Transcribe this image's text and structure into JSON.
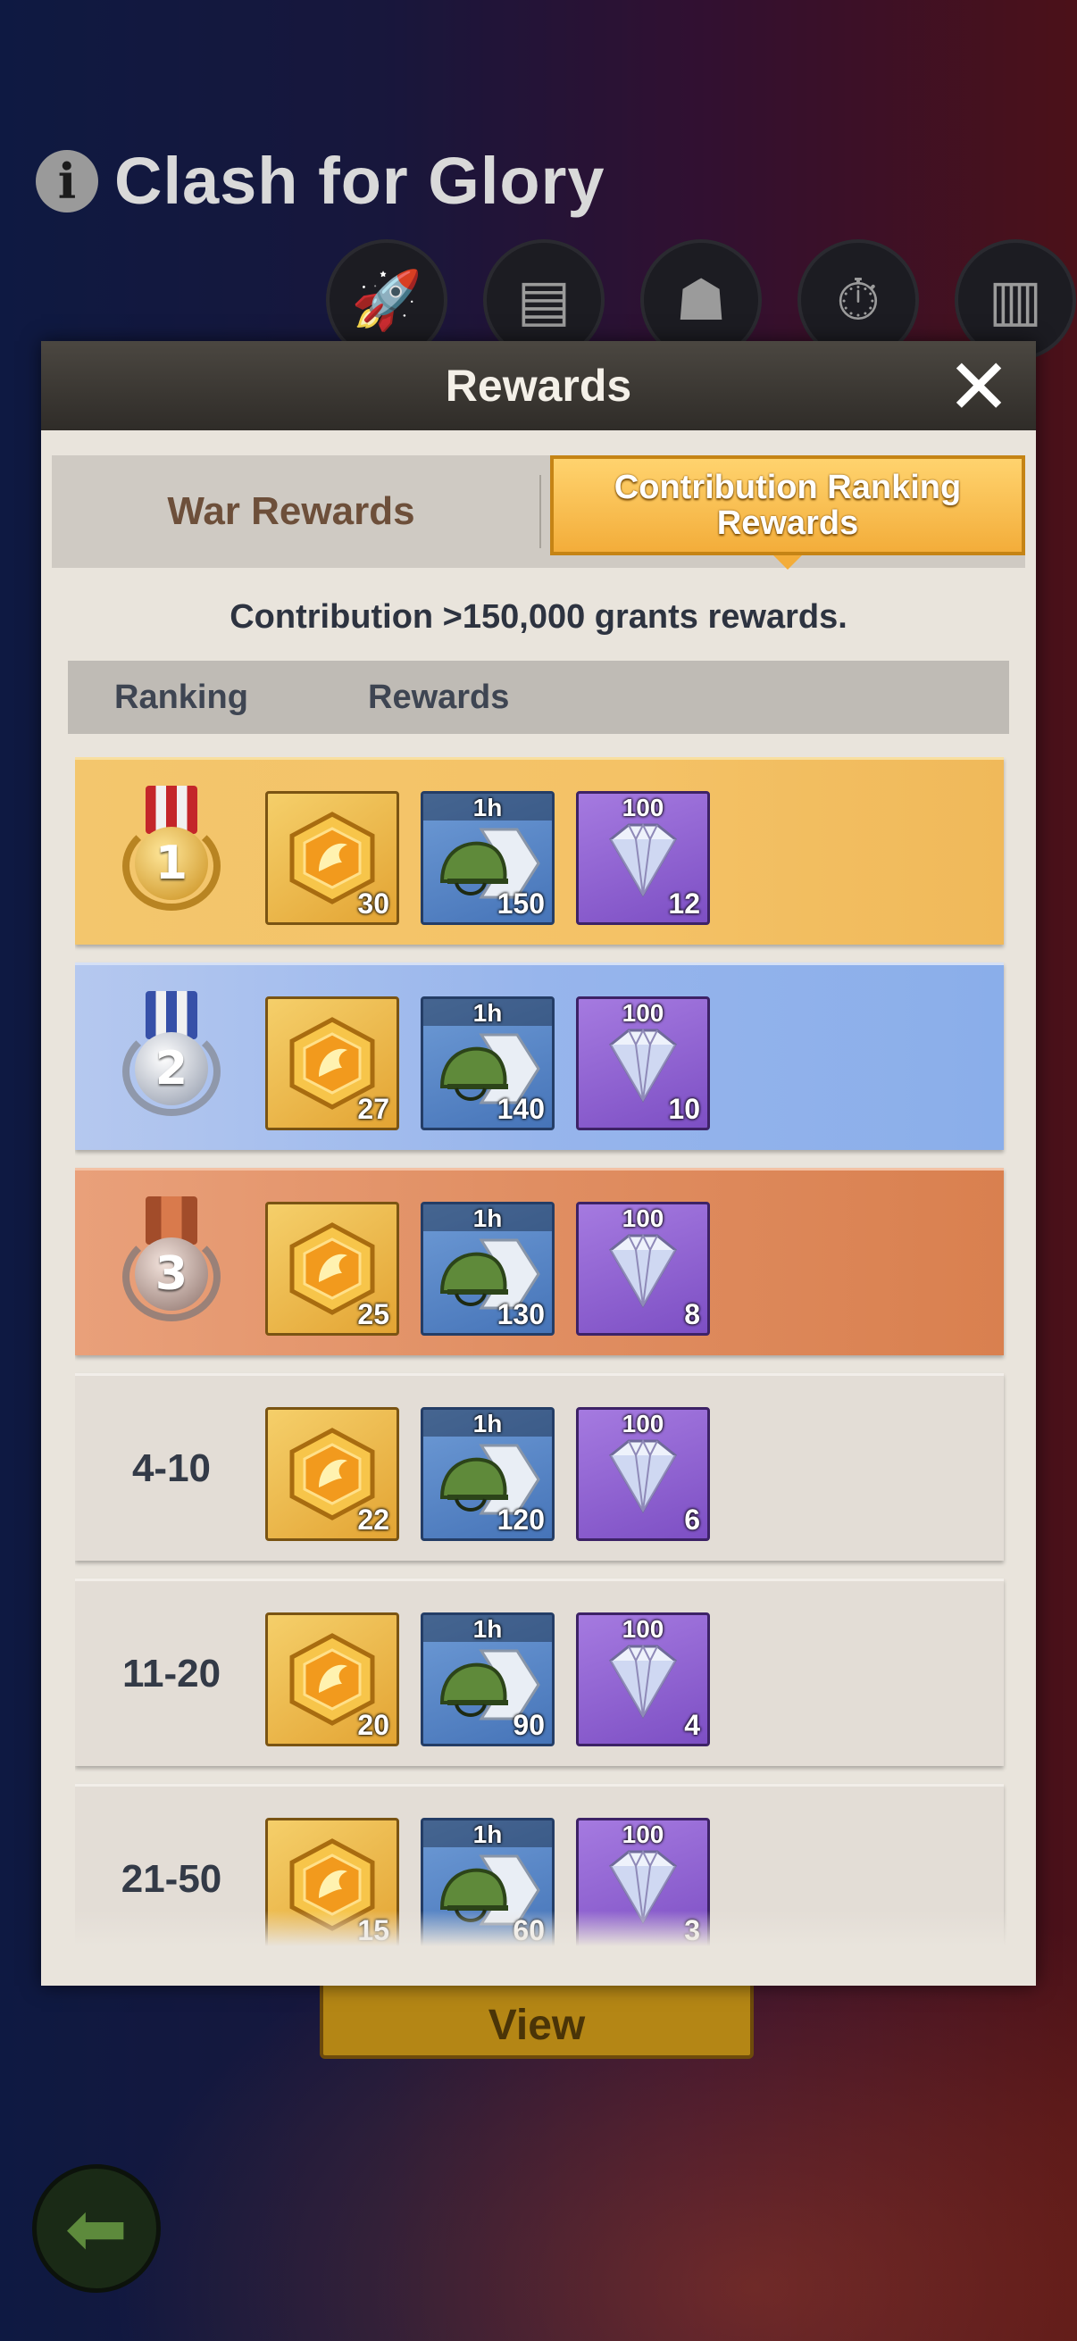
{
  "game": {
    "title": "Clash for Glory"
  },
  "feature_icons": [
    {
      "icon": "missile-icon"
    },
    {
      "icon": "document-icon"
    },
    {
      "icon": "soldier-gift-icon"
    },
    {
      "icon": "stopwatch-icon"
    },
    {
      "icon": "podium-icon"
    }
  ],
  "modal": {
    "title": "Rewards",
    "close_label": "✕",
    "tabs": {
      "war": "War Rewards",
      "contribution": "Contribution Ranking Rewards",
      "active": "contribution"
    },
    "threshold_text": "Contribution >150,000 grants rewards.",
    "columns": {
      "ranking": "Ranking",
      "rewards": "Rewards"
    },
    "item_labels": {
      "speedup_duration": "1h",
      "gem_amount": "100"
    },
    "rows": [
      {
        "rank": "1",
        "style": "gold",
        "medal": true,
        "medal_qty": "30",
        "speedup_qty": "150",
        "gem_qty": "12"
      },
      {
        "rank": "2",
        "style": "blue",
        "medal": true,
        "medal_qty": "27",
        "speedup_qty": "140",
        "gem_qty": "10"
      },
      {
        "rank": "3",
        "style": "bronze",
        "medal": true,
        "medal_qty": "25",
        "speedup_qty": "130",
        "gem_qty": "8"
      },
      {
        "rank": "4-10",
        "style": "plain",
        "medal": false,
        "medal_qty": "22",
        "speedup_qty": "120",
        "gem_qty": "6"
      },
      {
        "rank": "11-20",
        "style": "plain",
        "medal": false,
        "medal_qty": "20",
        "speedup_qty": "90",
        "gem_qty": "4"
      },
      {
        "rank": "21-50",
        "style": "plain",
        "medal": false,
        "medal_qty": "15",
        "speedup_qty": "60",
        "gem_qty": "3"
      }
    ]
  },
  "behind": {
    "view_button": "View"
  },
  "colors": {
    "gold_row": "#f4c266",
    "blue_row": "#97b5ec",
    "bronze_row": "#e08e62",
    "tab_active": "#f3ad3a"
  }
}
